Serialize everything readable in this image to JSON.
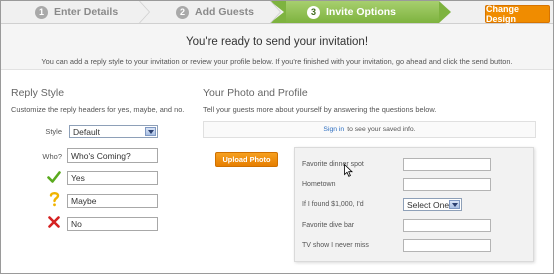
{
  "wizard": {
    "steps": [
      {
        "number": "1",
        "label": "Enter Details"
      },
      {
        "number": "2",
        "label": "Add Guests"
      },
      {
        "number": "3",
        "label": "Invite Options"
      }
    ],
    "active_step": 3,
    "change_design_label": "Change Design",
    "colors": {
      "active": "#7eb33f",
      "accent": "#f08c00"
    }
  },
  "intro": {
    "title": "You're ready to send your invitation!",
    "description": "You can add a reply style to your invitation or review your profile below. If you're finished with your invitation, go ahead and click the send button."
  },
  "reply_style": {
    "title": "Reply Style",
    "description": "Customize the reply headers for yes, maybe, and no.",
    "style_label": "Style",
    "style_value": "Default",
    "who_label": "Who?",
    "who_value": "Who's Coming?",
    "yes_value": "Yes",
    "maybe_value": "Maybe",
    "no_value": "No",
    "icons": {
      "yes": "checkmark-icon",
      "maybe": "question-mark-icon",
      "no": "x-mark-icon"
    }
  },
  "profile": {
    "title": "Your Photo and Profile",
    "description": "Tell your guests more about yourself by answering the questions below.",
    "signin_link": "Sign in",
    "signin_text": "to see your saved info.",
    "upload_label": "Upload Photo",
    "questions": {
      "q1": "Favorite dinner spot",
      "q2": "Hometown",
      "q3": "If I found $1,000, I'd",
      "q3_select": "Select One",
      "q4": "Favorite dive bar",
      "q5": "TV show I never miss"
    }
  }
}
